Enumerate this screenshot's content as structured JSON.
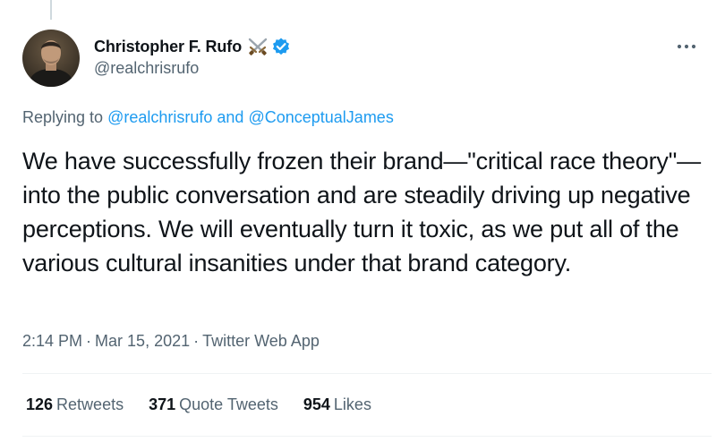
{
  "author": {
    "display_name": "Christopher F. Rufo",
    "handle": "@realchrisrufo",
    "name_emoji": "crossed-swords-icon",
    "verified": true
  },
  "more_icon": "more-horizontal-icon",
  "replying": {
    "prefix": "Replying to",
    "mention_1": "@realchrisrufo",
    "conjunction": "and",
    "mention_2": "@ConceptualJames"
  },
  "tweet": {
    "text": "We have successfully frozen their brand—\"critical race theory\"—into the public conversation and are steadily driving up negative perceptions. We will eventually turn it toxic, as we put all of the various cultural insanities under that brand category."
  },
  "meta": {
    "time": "2:14 PM",
    "date": "Mar 15, 2021",
    "source": "Twitter Web App",
    "separator": "·"
  },
  "stats": {
    "retweets_count": "126",
    "retweets_label": "Retweets",
    "quote_count": "371",
    "quote_label": "Quote Tweets",
    "likes_count": "954",
    "likes_label": "Likes"
  },
  "colors": {
    "link": "#1d9bf0",
    "secondary_text": "#536471",
    "primary_text": "#0f1419",
    "divider": "#eff3f4"
  }
}
